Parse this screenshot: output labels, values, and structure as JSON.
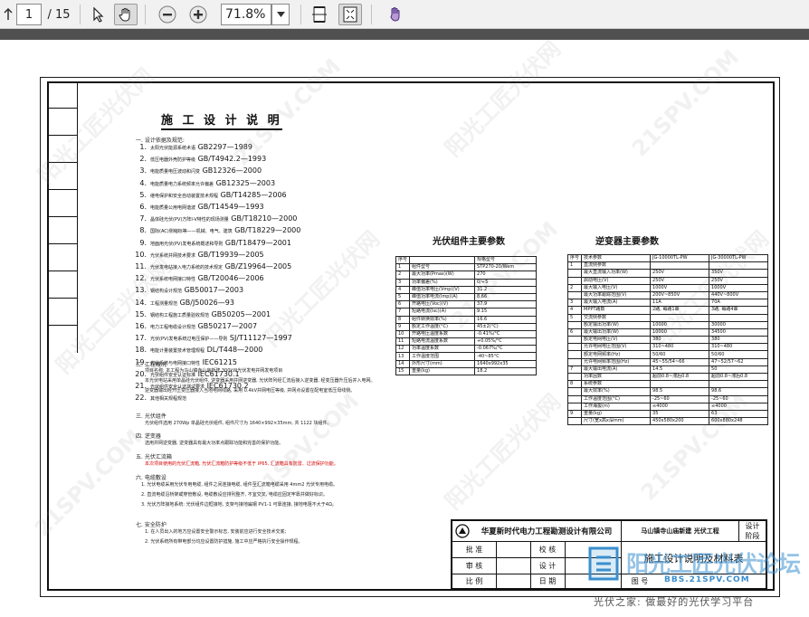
{
  "toolbar": {
    "page_current": "1",
    "page_total": "/ 15",
    "zoom_value": "71.8%"
  },
  "doc": {
    "title": "施 工 设 计 说 明",
    "section1": "一. 设计依据及规范:",
    "standards": [
      {
        "n": "1.",
        "text": "太阳光伏能源系统术语",
        "code": "GB2297—1989"
      },
      {
        "n": "2.",
        "text": "低压电器外壳防护等级",
        "code": "GB/T4942.2—1993"
      },
      {
        "n": "3.",
        "text": "电能质量电压波动和闪变",
        "code": "GB12326—2000"
      },
      {
        "n": "4.",
        "text": "电能质量电力系统频率允许偏差",
        "code": "GB12325—2003"
      },
      {
        "n": "5.",
        "text": "继电保护和安全自动装置技术规程",
        "code": "GB/T14285—2006"
      },
      {
        "n": "6.",
        "text": "电能质量公用电网谐波",
        "code": "GB/T14549—1993"
      },
      {
        "n": "7.",
        "text": "晶体硅光伏(PV)方阵I-V特性的现场测量",
        "code": "GB/T18210—2000"
      },
      {
        "n": "8.",
        "text": "国际(AC)侧缩标等——机械、电气、建筑",
        "code": "GB/T18229—2000"
      },
      {
        "n": "9.",
        "text": "地面用光伏(PV)发电系统概述和导则",
        "code": "GB/T18479—2001"
      },
      {
        "n": "10.",
        "text": "光伏系统并网技术要求",
        "code": "GB/T19939—2005"
      },
      {
        "n": "11.",
        "text": "光伏发电站接入电力系统的技术规定",
        "code": "GB/Z19964—2005"
      },
      {
        "n": "12.",
        "text": "光伏系统电网接口特性",
        "code": "GB/T20046—2006"
      },
      {
        "n": "13.",
        "text": "钢结构设计规范",
        "code": "GB50017—2003"
      },
      {
        "n": "14.",
        "text": "工程测量规范",
        "code": "GB/J50026—93"
      },
      {
        "n": "15.",
        "text": "钢结构工程施工质量验收规范",
        "code": "GB50205—2001"
      },
      {
        "n": "16.",
        "text": "电力工程电缆设计规范",
        "code": "GB50217—2007"
      },
      {
        "n": "17.",
        "text": "光伏(PV)发电系统过电压保护——导则",
        "code": "SJ/T11127—1997"
      },
      {
        "n": "18.",
        "text": "电能计量装置技术管理规程",
        "code": "DL/T448—2000"
      },
      {
        "n": "19.",
        "text": "光伏系统与电网接口特性",
        "code": "IEC61215"
      },
      {
        "n": "20.",
        "text": "光伏组件安全认证标准",
        "code": "IEC61730.1"
      },
      {
        "n": "21.",
        "text": "光伏组件安全认证测试要求",
        "code": "IEC61730.2"
      },
      {
        "n": "22.",
        "text": "其他相关规程规范",
        "code": ""
      }
    ],
    "section2": "二. 工程概况",
    "overview": [
      "项目名称: 本工程为马山镇寺山庙新建 300kW光伏发电并网发电项目",
      "本光伏电站采用单晶硅光伏组件, 逆变器采用并网逆变器, 光伏阵列经汇流后接入逆变器, 经变压器升压后并入电网。",
      "逆变器输出经升压变压器接入当地电网线路, 采用 0.4kV并网电压等级, 并网点设置在配电室低压母线侧。"
    ],
    "section3": "三. 光伏组件",
    "modules": "光伏组件选用 270Wp 单晶硅光伏组件, 组件尺寸为 1640×992×35mm, 共 1122 块组件。",
    "section4": "四. 逆变器",
    "inverter": "选用并网逆变器, 逆变器具有最大功率点跟踪功能和完善的保护功能。",
    "section5": "五. 光伏汇流箱",
    "combiner": "本次项目使用的光伏汇流箱, 光伏汇流箱防护等级不低于 IP65, 汇流箱具有防雷、过流保护功能。",
    "section6": "六. 电缆敷设",
    "cables": [
      "1. 光伏电缆采用光伏专用电缆, 组件之间连接电缆, 组件至汇流箱电缆采用 4mm2 光伏专用电缆。",
      "2. 直流电缆沿桥架或穿管敷设, 电缆敷设应排列整齐, 不宜交叉, 电缆应固定牢靠并做好标识。",
      "3. 光伏方阵接地系统: 光伏组件边框接地, 支架与接地扁钢 PV1-1 可靠连接, 接地电阻不大于4Ω。"
    ],
    "section7": "七. 安全防护",
    "safety": [
      "1. 在人员出入的地方应设置安全警示标志, 安装前应进行安全技术交底;",
      "2. 光伏系统所有带电部分均应设置防护措施, 施工中应严格执行安全操作规程。"
    ]
  },
  "pv_table": {
    "title": "光伏组件主要参数",
    "header": [
      "序号",
      "",
      "规格型号"
    ],
    "rows": [
      [
        "1",
        "组件型号",
        "STP270-20/Wem"
      ],
      [
        "2",
        "最大功率(Pmax)(W)",
        "270"
      ],
      [
        "3",
        "功率偏差(%)",
        "0/+5"
      ],
      [
        "4",
        "峰值功率电压(Vmp)(V)",
        "31.2"
      ],
      [
        "5",
        "峰值功率电流(Imp)(A)",
        "8.66"
      ],
      [
        "6",
        "开路电压(Voc)(V)",
        "37.9"
      ],
      [
        "7",
        "短路电流(Isc)(A)",
        "9.15"
      ],
      [
        "8",
        "组件转换效率(%)",
        "16.6"
      ],
      [
        "9",
        "额定工作温度(°C)",
        "45±2(°C)"
      ],
      [
        "10",
        "开路电压温度系数",
        "-0.41%/°C"
      ],
      [
        "11",
        "短路电流温度系数",
        "+0.05%/°C"
      ],
      [
        "12",
        "功率温度系数",
        "-0.067%/°C"
      ],
      [
        "13",
        "工作温度范围",
        "-40~85°C"
      ],
      [
        "14",
        "外形尺寸(mm)",
        "1640x992x35"
      ],
      [
        "15",
        "重量(kg)",
        "18.2"
      ]
    ]
  },
  "inv_table": {
    "title": "逆变器主要参数",
    "header": [
      "序号",
      "技术参数",
      "JG-10000TL-PW",
      "JG-30000TL-PW"
    ],
    "rows": [
      [
        "1",
        "直流侧参数",
        "",
        ""
      ],
      [
        "",
        "最大直流输入功率(W)",
        "250V",
        "350V"
      ],
      [
        "",
        "启动电压(V)",
        "250V",
        "250V"
      ],
      [
        "2",
        "最大输入电压(V)",
        "1000V",
        "1000V"
      ],
      [
        "",
        "最大功率跟踪范围(V)",
        "200V~850V",
        "440V~800V"
      ],
      [
        "3",
        "最大输入电流(A)",
        "11A",
        "70A"
      ],
      [
        "4",
        "MPPT路数",
        "2路, 每路1串",
        "3路, 每路4串"
      ],
      [
        "5",
        "交流侧参数",
        "",
        ""
      ],
      [
        "",
        "额定输出功率(W)",
        "10000",
        "30000"
      ],
      [
        "6",
        "最大输出功率(W)",
        "10000",
        "34500"
      ],
      [
        "",
        "额定电网电压(V)",
        "380",
        "380"
      ],
      [
        "",
        "允许电网电压范围(V)",
        "310~480",
        "310~480"
      ],
      [
        "",
        "额定电网频率(Hz)",
        "50/60",
        "50/60"
      ],
      [
        "",
        "允许电网频率范围(Hz)",
        "45~55/54~66",
        "47~52/57~62"
      ],
      [
        "7",
        "最大输出电流(A)",
        "14.5",
        "50"
      ],
      [
        "",
        "功率因数",
        "超前0.8~滞后0.8",
        "超前0.8~滞后0.8"
      ],
      [
        "8",
        "系统参数",
        "",
        ""
      ],
      [
        "",
        "最大效率(%)",
        "98.5",
        "98.6"
      ],
      [
        "",
        "工作温度范围(°C)",
        "-25~60",
        "-25~60"
      ],
      [
        "",
        "工作海拔(m)",
        "≤4000",
        "≤4000"
      ],
      [
        "9",
        "重量(kg)",
        "35",
        "63"
      ],
      [
        "",
        "尺寸(宽x高x深mm)",
        "450x580x200",
        "600x880x248"
      ]
    ]
  },
  "titleblock": {
    "company": "华夏新时代电力工程勘测设计有限公司",
    "project": "马山镇寺山庙新建 光伏工程",
    "stage_1": "设计",
    "stage_2": "阶段",
    "approve": "批 准",
    "check": "校 核",
    "review": "审 核",
    "design": "设 计",
    "scale": "比 例",
    "date": "日 期",
    "drawing_name": "施工设计说明及材料表",
    "drawing_no": "图 号"
  },
  "watermark": {
    "text1": "阳光工匠光伏网",
    "text2": "21SPV.COM"
  },
  "brand": {
    "logo_text": "阳光工匠光伏论坛",
    "logo_url": "BBS.21SPV.COM",
    "footer": "光伏之家: 做最好的光伏学习平台"
  },
  "colors": {
    "toolbar_bg": "#f1f1f1",
    "dark_bar": "#505050",
    "accent_red": "#d40000",
    "logo_blue": "#3a8fcf"
  },
  "icons": {
    "prev_page": "page-up-icon",
    "select_tool": "select-arrow-icon",
    "hand_tool": "hand-icon",
    "zoom_out": "zoom-out-icon",
    "zoom_in": "zoom-in-icon",
    "fit_page": "fit-page-icon",
    "fit_width": "fit-width-icon",
    "read_mode": "read-mode-icon"
  }
}
